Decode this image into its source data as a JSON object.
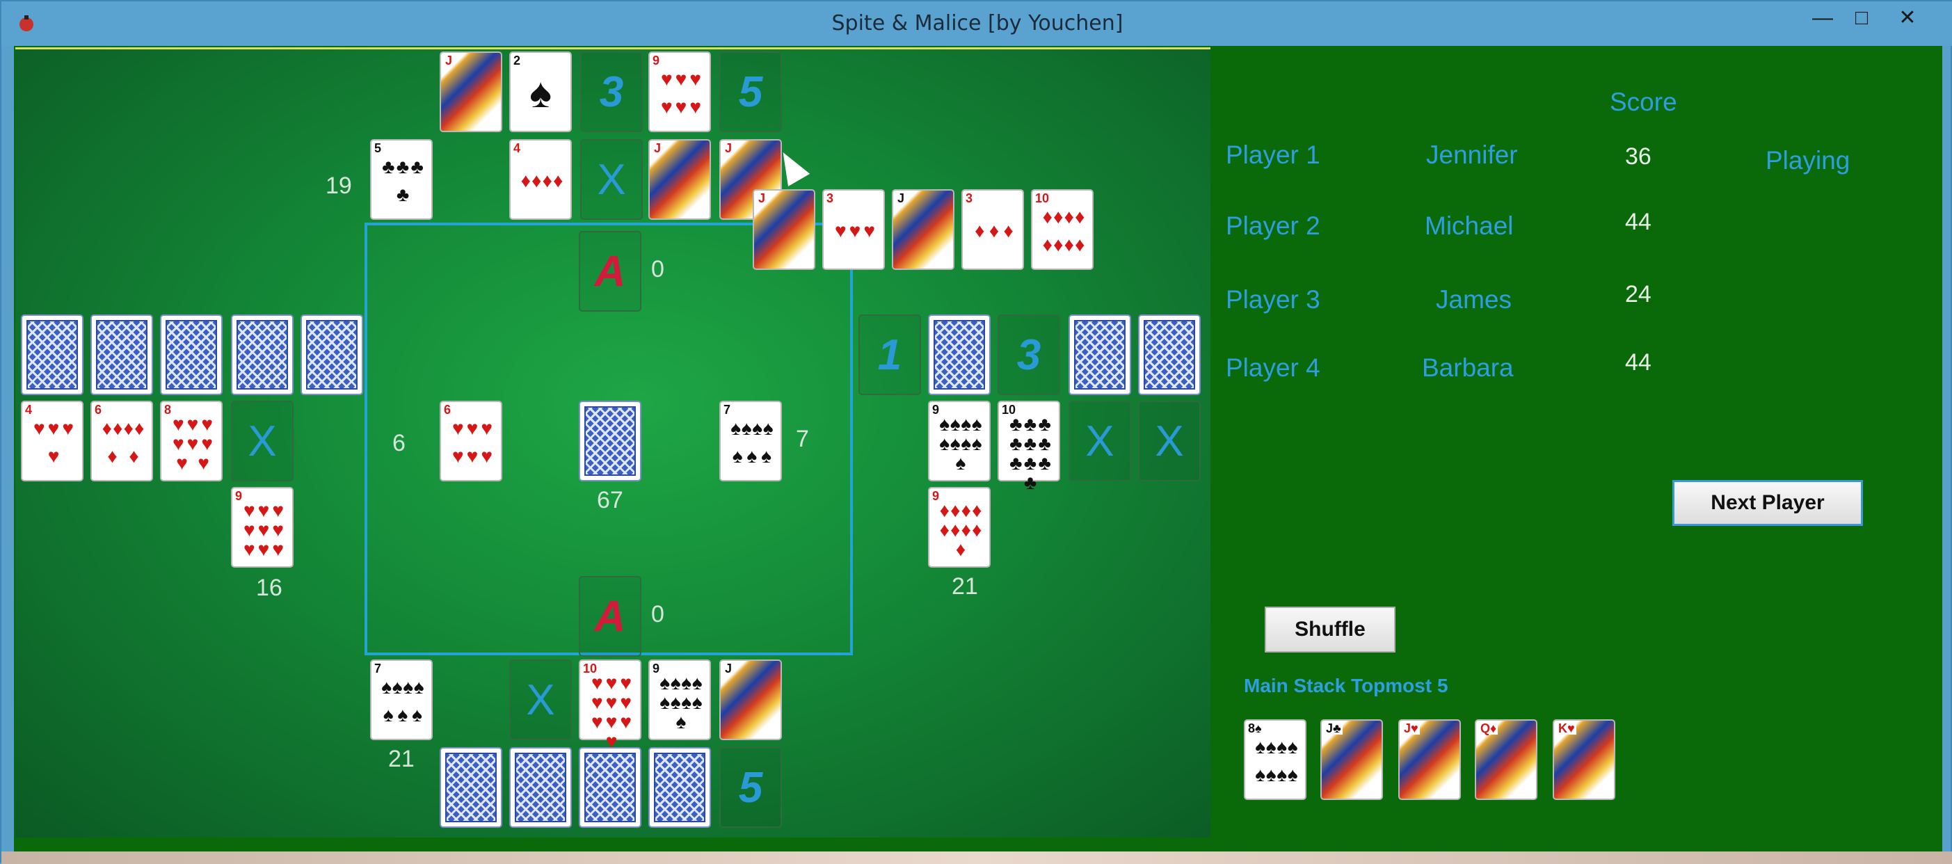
{
  "window": {
    "title": "Spite & Malice [by Youchen]",
    "minimize": "—",
    "maximize": "□",
    "close": "✕"
  },
  "scoreboard": {
    "score_header": "Score",
    "players": [
      {
        "label": "Player 1",
        "name": "Jennifer",
        "score": "36",
        "status": "Playing"
      },
      {
        "label": "Player 2",
        "name": "Michael",
        "score": "44",
        "status": ""
      },
      {
        "label": "Player 3",
        "name": "James",
        "score": "24",
        "status": ""
      },
      {
        "label": "Player 4",
        "name": "Barbara",
        "score": "44",
        "status": ""
      }
    ]
  },
  "buttons": {
    "next_player": "Next Player",
    "shuffle": "Shuffle"
  },
  "main_stack": {
    "label": "Main Stack Topmost 5",
    "cards": [
      "8♠",
      "J♣",
      "J♥",
      "Q♦",
      "K♥"
    ]
  },
  "counts": {
    "top_player": "19",
    "left_player": "16",
    "right_player": "21",
    "bottom_player": "21",
    "center_left": "6",
    "center_right": "7",
    "deck": "67",
    "top_ace": "0",
    "bottom_ace": "0"
  },
  "slot_labels": {
    "three": "3",
    "five": "5",
    "one": "1",
    "x": "X",
    "ace": "A"
  },
  "cards": {
    "top_row1": [
      "J",
      "2",
      "9"
    ],
    "top_row2": [
      "5",
      "4",
      "J",
      "J"
    ],
    "hand": [
      "J",
      "3",
      "J",
      "3",
      "10"
    ],
    "left_row2": [
      "4",
      "6",
      "8"
    ],
    "left_extra": "9",
    "center_left": "6",
    "center_right": "7",
    "right_row2": [
      "9",
      "10"
    ],
    "right_extra": "9",
    "bottom_row1": [
      "7",
      "10",
      "9",
      "J"
    ]
  }
}
